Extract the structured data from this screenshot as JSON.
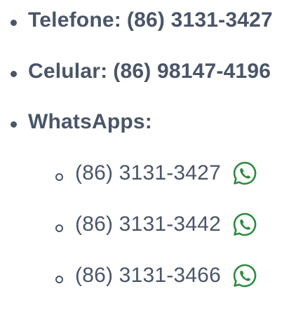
{
  "contacts": {
    "telefone": {
      "label": "Telefone:",
      "value": "(86) 3131-3427"
    },
    "celular": {
      "label": "Celular:",
      "value": "(86) 98147-4196"
    },
    "whatsapps": {
      "label": "WhatsApps:",
      "numbers": [
        {
          "value": "(86) 3131-3427",
          "icon": "whatsapp-icon"
        },
        {
          "value": "(86) 3131-3442",
          "icon": "whatsapp-icon"
        },
        {
          "value": "(86) 3131-3466",
          "icon": "whatsapp-icon"
        }
      ]
    }
  }
}
